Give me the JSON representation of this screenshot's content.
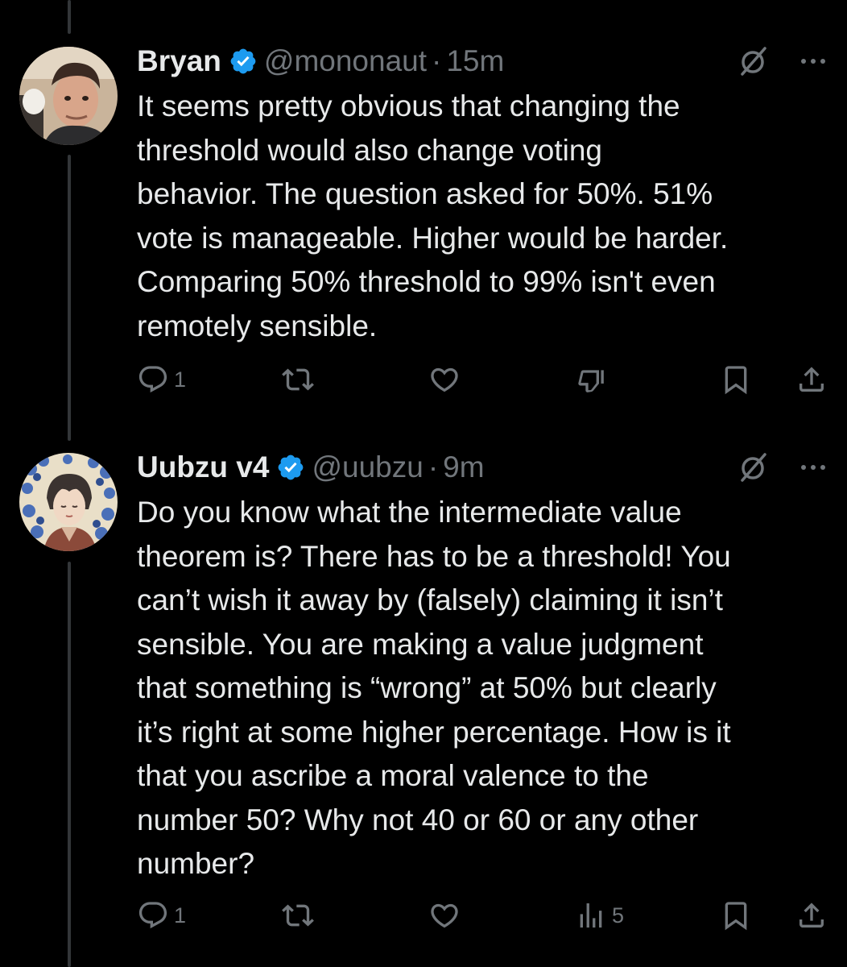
{
  "tweets": [
    {
      "display_name": "Bryan",
      "handle": "@mononaut",
      "separator": "·",
      "time": "15m",
      "lines": [
        "It seems pretty obvious that changing the",
        "threshold would also change voting",
        "behavior. The question asked for 50%. 51%",
        "vote is manageable. Higher would be harder.",
        "Comparing 50% threshold to 99% isn't even",
        "remotely sensible."
      ],
      "reply_count": "1",
      "views_count": ""
    },
    {
      "display_name": "Uubzu v4",
      "handle": "@uubzu",
      "separator": "·",
      "time": "9m",
      "lines": [
        "Do you know what the intermediate value",
        "theorem is? There has to be a threshold! You",
        "can’t wish it away by (falsely) claiming it isn’t",
        "sensible. You are making a value judgment",
        "that something is “wrong” at 50% but clearly",
        "it’s right at some higher percentage. How is it",
        "that you ascribe a moral valence to the",
        "number 50? Why not 40 or 60 or any other",
        "number?"
      ],
      "reply_count": "1",
      "views_count": "5"
    }
  ],
  "colors": {
    "background": "#000000",
    "text": "#e7e9ea",
    "secondary": "#71767b",
    "verified": "#1d9bf0",
    "thread_line": "#333639"
  },
  "icons": {
    "verified": "verified-badge-icon",
    "grok": "grok-icon",
    "more": "more-icon",
    "reply": "reply-icon",
    "repost": "repost-icon",
    "like": "like-icon",
    "dislike": "downvote-icon",
    "views": "views-icon",
    "bookmark": "bookmark-icon",
    "share": "share-icon"
  }
}
